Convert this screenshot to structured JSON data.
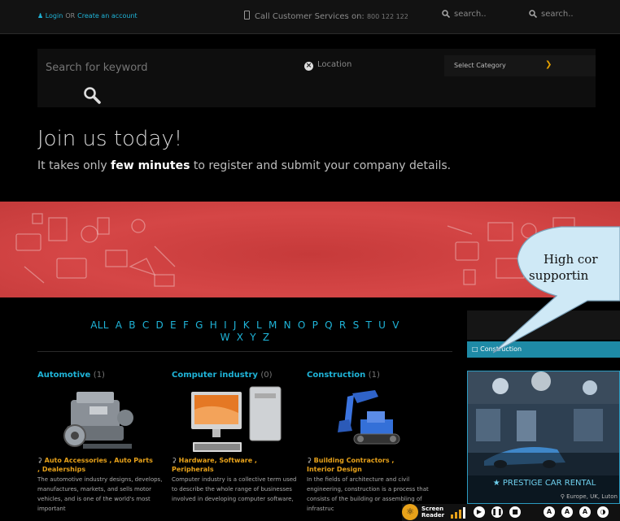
{
  "topbar": {
    "login": "Login",
    "or": "OR",
    "create": "Create an account",
    "phone_label": "Call Customer Services on:",
    "phone_number": "800 122 122",
    "search1": "search..",
    "search2": "search.."
  },
  "hero": {
    "keyword_placeholder": "Search for keyword",
    "location": "Location",
    "category": "Select Category",
    "title": "Join us today!",
    "sub_pre": "It takes only ",
    "sub_bold": "few minutes",
    "sub_post": " to register and submit your company details."
  },
  "callout": {
    "line1": "High cor",
    "line2": "supportin"
  },
  "alphabet": [
    "ALL",
    "A",
    "B",
    "C",
    "D",
    "E",
    "F",
    "G",
    "H",
    "I",
    "J",
    "K",
    "L",
    "M",
    "N",
    "O",
    "P",
    "Q",
    "R",
    "S",
    "T",
    "U",
    "V",
    "W",
    "X",
    "Y",
    "Z"
  ],
  "categories": [
    {
      "title": "Automotive",
      "count": "(1)",
      "links1": "Auto Accessories , Auto Parts",
      "links2": ", Dealerships",
      "desc": "The automotive industry designs, develops, manufactures, markets, and sells motor vehicles, and is one of the world's most important"
    },
    {
      "title": "Computer industry",
      "count": "(0)",
      "links1": "Hardware, Software ,",
      "links2": "Peripherals",
      "desc": "Computer industry is a collective term used to describe the whole range of businesses involved in developing computer software,"
    },
    {
      "title": "Construction",
      "count": "(1)",
      "links1": "Building Contractors ,",
      "links2": "Interior Design",
      "desc": "In the fields of architecture and civil engineering, construction is a process that consists of the building or assembling of infrastruc"
    }
  ],
  "sidebar": {
    "category": "Construction",
    "featured_title": "PRESTIGE CAR RENTAL",
    "featured_location": "Europe, UK, Luton"
  },
  "screenreader": {
    "label1": "Screen",
    "label2": "Reader"
  },
  "colors": {
    "accent": "#1fb4d8",
    "link": "#e8a21a",
    "banner": "#d54646"
  }
}
